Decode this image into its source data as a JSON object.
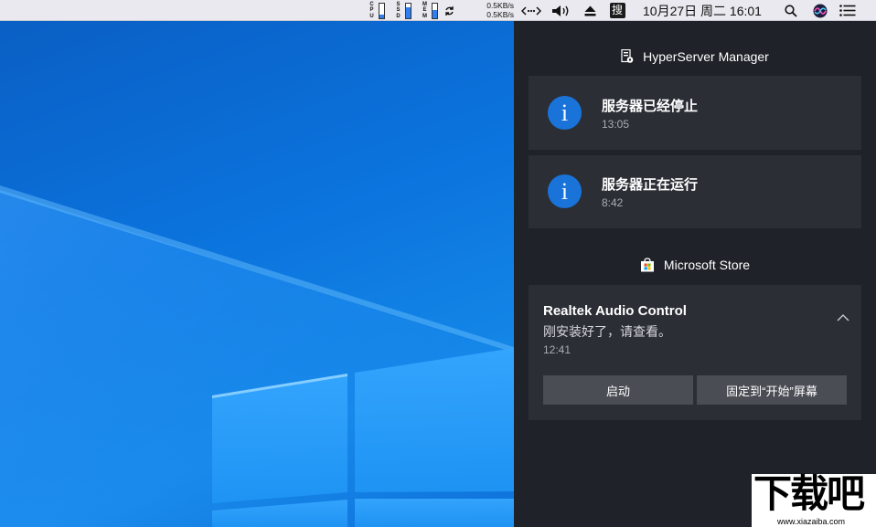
{
  "menubar": {
    "meters": [
      {
        "name": "cpu",
        "label": "CPU",
        "level": 0.25
      },
      {
        "name": "ssd",
        "label": "SSD",
        "level": 0.75
      },
      {
        "name": "mem",
        "label": "MEM",
        "level": 0.55
      }
    ],
    "net": {
      "up": "0.5KB/s",
      "down": "0.5KB/s"
    },
    "input_method": "搜",
    "clock": "10月27日 周二 16:01"
  },
  "action_center": {
    "groups": [
      {
        "app": "HyperServer Manager",
        "notifications": [
          {
            "title": "服务器已经停止",
            "time": "13:05",
            "icon": "info-icon"
          },
          {
            "title": "服务器正在运行",
            "time": "8:42",
            "icon": "info-icon"
          }
        ]
      },
      {
        "app": "Microsoft Store",
        "notification": {
          "title": "Realtek Audio Control",
          "body": "刚安装好了，请查看。",
          "time": "12:41",
          "buttons": [
            "启动",
            "固定到“开始”屏幕"
          ]
        }
      }
    ]
  },
  "watermark": {
    "text": "下载吧",
    "url": "www.xiazaiba.com"
  },
  "colors": {
    "accent": "#1a73d9",
    "panel": "#1f2228",
    "card": "#2b2e35",
    "button": "#4a4d54"
  }
}
